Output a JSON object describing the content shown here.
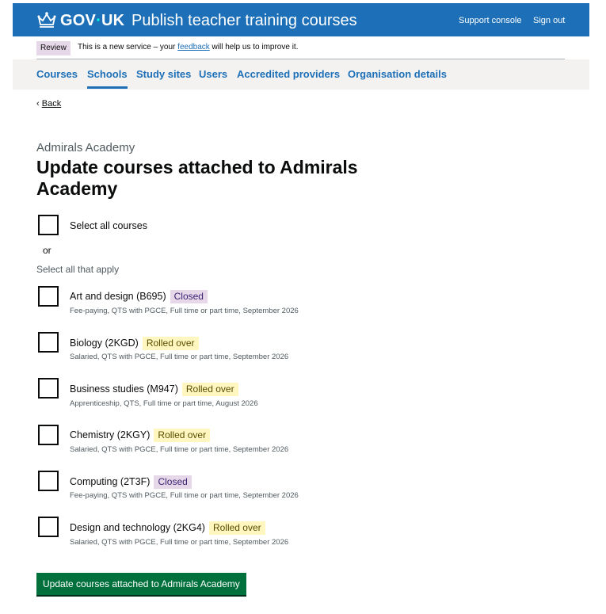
{
  "header": {
    "logo_text": "GOV",
    "logo_dot": "·",
    "logo_suffix": "UK",
    "service_name": "Publish teacher training courses",
    "links": [
      "Support console",
      "Sign out"
    ]
  },
  "phase_banner": {
    "tag": "Review",
    "text_before": "This is a new service – your ",
    "link": "feedback",
    "text_after": " will help us to improve it."
  },
  "nav": {
    "items": [
      "Courses",
      "Schools",
      "Study sites",
      "Users",
      "Accredited providers",
      "Organisation details"
    ],
    "active": "Schools"
  },
  "back": {
    "arrow": "‹",
    "label": "Back"
  },
  "caption": "Admirals Academy",
  "title": "Update courses attached to Admirals Academy",
  "select_all": "Select all courses",
  "or": "or",
  "legend": "Select all that apply",
  "courses": [
    {
      "name": "Art and design (B695)",
      "status": "Closed",
      "hint": "Fee-paying, QTS with PGCE, Full time or part time, September 2026"
    },
    {
      "name": "Biology (2KGD)",
      "status": "Rolled over",
      "hint": "Salaried, QTS with PGCE, Full time or part time, September 2026"
    },
    {
      "name": "Business studies (M947)",
      "status": "Rolled over",
      "hint": "Apprenticeship, QTS, Full time or part time, August 2026"
    },
    {
      "name": "Chemistry (2KGY)",
      "status": "Rolled over",
      "hint": "Salaried, QTS with PGCE, Full time or part time, September 2026"
    },
    {
      "name": "Computing (2T3F)",
      "status": "Closed",
      "hint": "Fee-paying, QTS with PGCE, Full time or part time, September 2026"
    },
    {
      "name": "Design and technology (2KG4)",
      "status": "Rolled over",
      "hint": "Salaried, QTS with PGCE, Full time or part time, September 2026"
    }
  ],
  "submit_label": "Update courses attached to Admirals Academy",
  "colors": {
    "header_blue": "#1d70b8",
    "link_blue": "#1d70b8",
    "button_green": "#00703c",
    "tag_closed": "#e6d8e8",
    "tag_rolled": "#fff7bf"
  }
}
